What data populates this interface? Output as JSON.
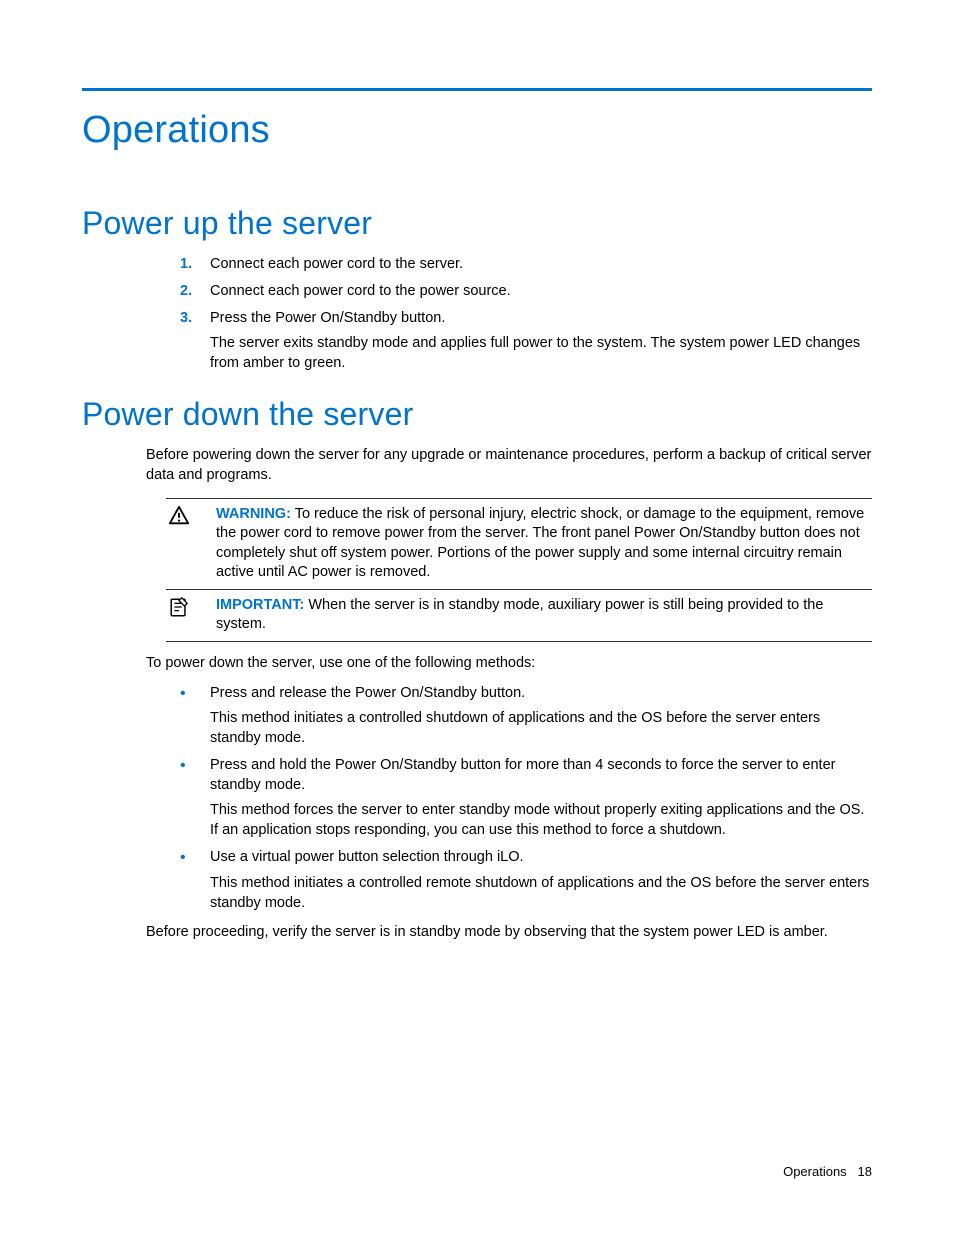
{
  "chapter_title": "Operations",
  "section1": {
    "title": "Power up the server",
    "steps": [
      {
        "num": "1.",
        "text": "Connect each power cord to the server."
      },
      {
        "num": "2.",
        "text": "Connect each power cord to the power source."
      },
      {
        "num": "3.",
        "text": "Press the Power On/Standby button.",
        "extra": "The server exits standby mode and applies full power to the system. The system power LED changes from amber to green."
      }
    ]
  },
  "section2": {
    "title": "Power down the server",
    "intro": "Before powering down the server for any upgrade or maintenance procedures, perform a backup of critical server data and programs.",
    "warning_label": "WARNING:",
    "warning_text": "To reduce the risk of personal injury, electric shock, or damage to the equipment, remove the power cord to remove power from the server. The front panel Power On/Standby button does not completely shut off system power. Portions of the power supply and some internal circuitry remain active until AC power is removed.",
    "important_label": "IMPORTANT:",
    "important_text": "When the server is in standby mode, auxiliary power is still being provided to the system.",
    "methods_intro": "To power down the server, use one of the following methods:",
    "methods": [
      {
        "primary": "Press and release the Power On/Standby button.",
        "secondary": "This method initiates a controlled shutdown of applications and the OS before the server enters standby mode."
      },
      {
        "primary": "Press and hold the Power On/Standby button for more than 4 seconds to force the server to enter standby mode.",
        "secondary": "This method forces the server to enter standby mode without properly exiting applications and the OS. If an application stops responding, you can use this method to force a shutdown."
      },
      {
        "primary": "Use a virtual power button selection through iLO.",
        "secondary": "This method initiates a controlled remote shutdown of applications and the OS before the server enters standby mode."
      }
    ],
    "closing": "Before proceeding, verify the server is in standby mode by observing that the system power LED is amber."
  },
  "footer": {
    "section": "Operations",
    "page": "18"
  }
}
